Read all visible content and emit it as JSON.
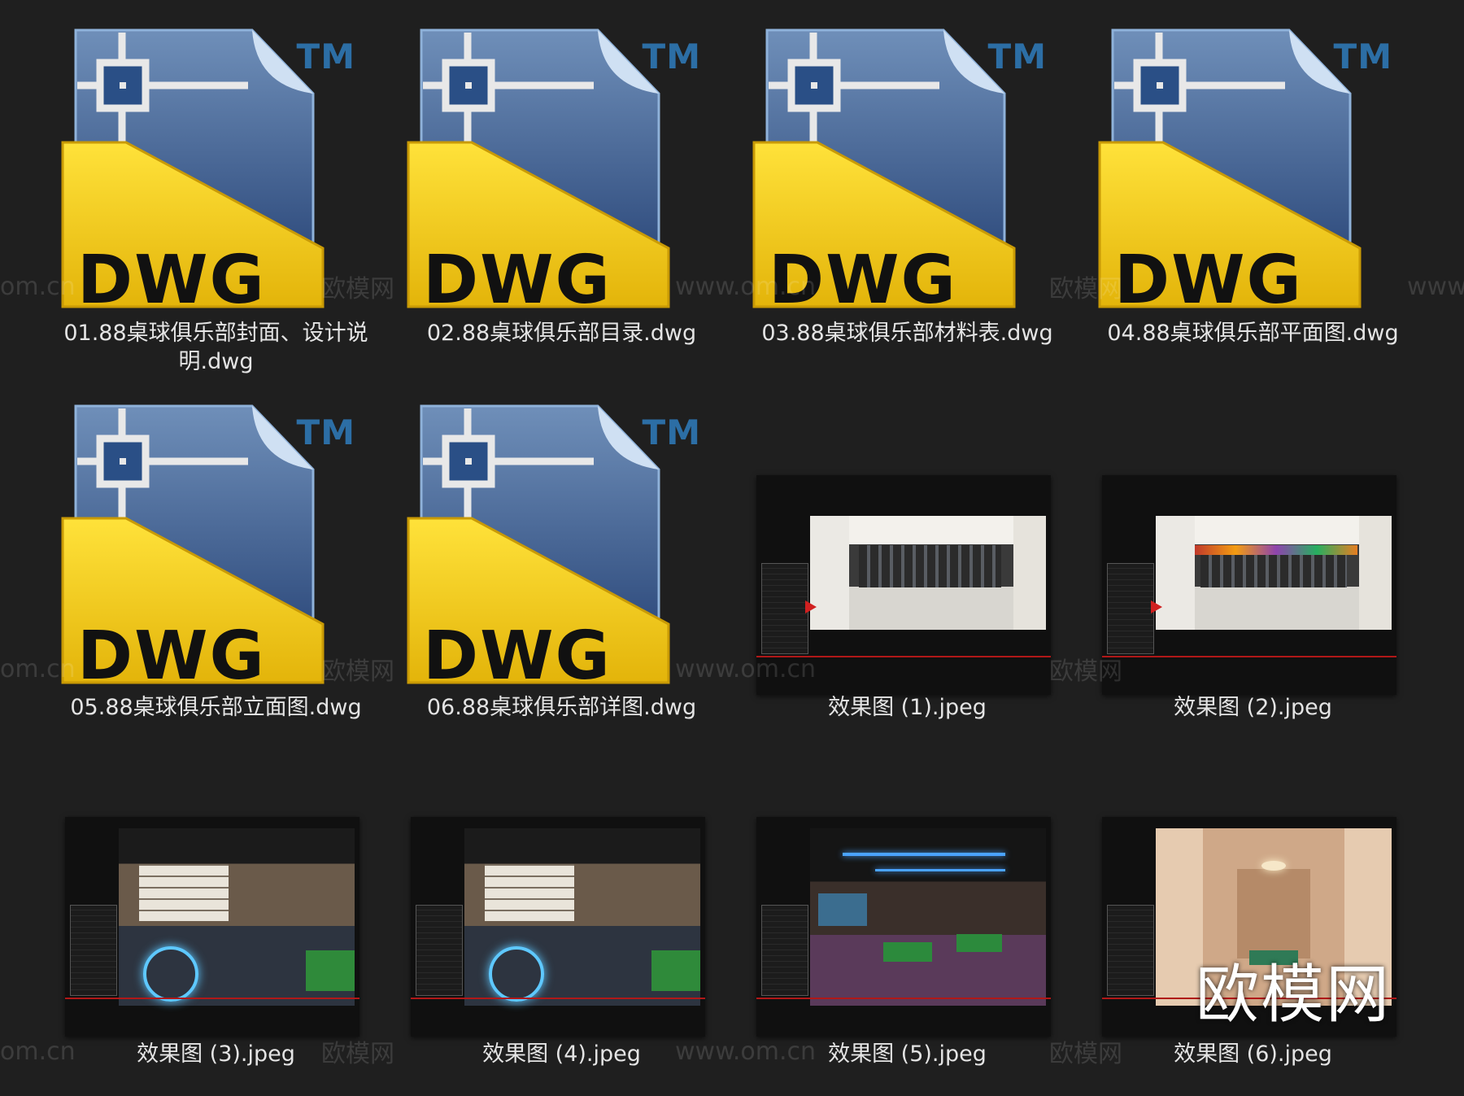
{
  "files": [
    {
      "name": "01.88桌球俱乐部封面、设计说明.dwg",
      "type": "dwg"
    },
    {
      "name": "02.88桌球俱乐部目录.dwg",
      "type": "dwg"
    },
    {
      "name": "03.88桌球俱乐部材料表.dwg",
      "type": "dwg"
    },
    {
      "name": "04.88桌球俱乐部平面图.dwg",
      "type": "dwg"
    },
    {
      "name": "05.88桌球俱乐部立面图.dwg",
      "type": "dwg"
    },
    {
      "name": "06.88桌球俱乐部详图.dwg",
      "type": "dwg"
    },
    {
      "name": "效果图 (1).jpeg",
      "type": "jpeg"
    },
    {
      "name": "效果图 (2).jpeg",
      "type": "jpeg"
    },
    {
      "name": "效果图 (3).jpeg",
      "type": "jpeg"
    },
    {
      "name": "效果图 (4).jpeg",
      "type": "jpeg"
    },
    {
      "name": "效果图 (5).jpeg",
      "type": "jpeg"
    },
    {
      "name": "效果图 (6).jpeg",
      "type": "jpeg"
    }
  ],
  "icon": {
    "label": "DWG",
    "trademark": "TM"
  },
  "watermarks": {
    "text": "欧模网",
    "url": "www.om.cn",
    "url_short": "om.cn"
  },
  "brand": "欧模网",
  "colors": {
    "background": "#1f1f1f",
    "dwg_yellow": "#f2c811",
    "dwg_blue": "#2a4f86",
    "accent_red": "#b01818"
  }
}
